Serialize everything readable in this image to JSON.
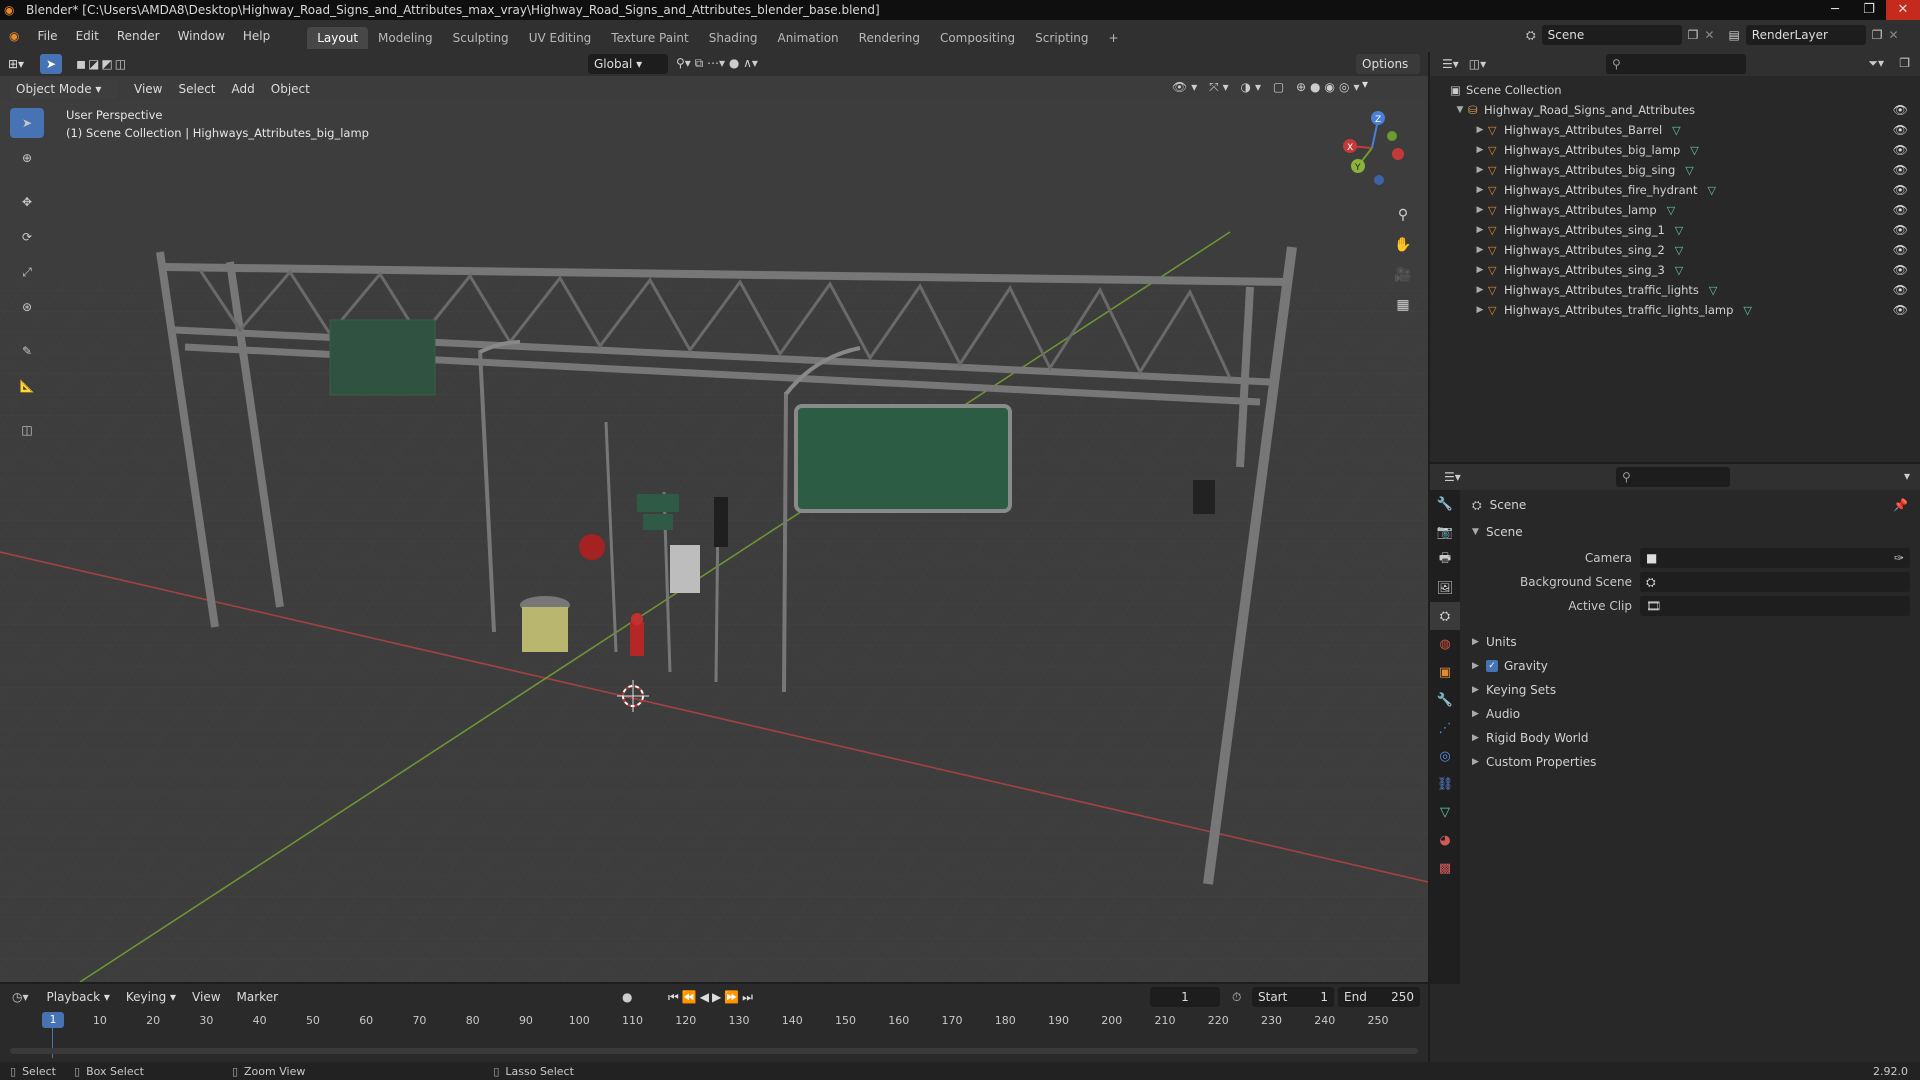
{
  "window": {
    "title": "Blender* [C:\\Users\\AMDA8\\Desktop\\Highway_Road_Signs_and_Attributes_max_vray\\Highway_Road_Signs_and_Attributes_blender_base.blend]",
    "minimize": "─",
    "maximize": "❐",
    "close": "✕"
  },
  "menu": [
    "File",
    "Edit",
    "Render",
    "Window",
    "Help"
  ],
  "workspaces": [
    "Layout",
    "Modeling",
    "Sculpting",
    "UV Editing",
    "Texture Paint",
    "Shading",
    "Animation",
    "Rendering",
    "Compositing",
    "Scripting"
  ],
  "workspace_add": "+",
  "scene_field": "Scene",
  "renderlayer_field": "RenderLayer",
  "viewport": {
    "transform_orientation": "Global",
    "options_label": "Options",
    "mode": "Object Mode",
    "header_menus": [
      "View",
      "Select",
      "Add",
      "Object"
    ],
    "overlay_title": "User Perspective",
    "overlay_sub": "(1) Scene Collection | Highways_Attributes_big_lamp",
    "gizmo": {
      "x": "X",
      "y": "Y",
      "z": "Z"
    }
  },
  "outliner": {
    "root": "Scene Collection",
    "collection": "Highway_Road_Signs_and_Attributes",
    "items": [
      "Highways_Attributes_Barrel",
      "Highways_Attributes_big_lamp",
      "Highways_Attributes_big_sing",
      "Highways_Attributes_fire_hydrant",
      "Highways_Attributes_lamp",
      "Highways_Attributes_sing_1",
      "Highways_Attributes_sing_2",
      "Highways_Attributes_sing_3",
      "Highways_Attributes_traffic_lights",
      "Highways_Attributes_traffic_lights_lamp"
    ]
  },
  "properties": {
    "context": "Scene",
    "panel": "Scene",
    "camera_label": "Camera",
    "bgscene_label": "Background Scene",
    "clip_label": "Active Clip",
    "sections": [
      "Units",
      "Gravity",
      "Keying Sets",
      "Audio",
      "Rigid Body World",
      "Custom Properties"
    ]
  },
  "timeline": {
    "menus": [
      "Playback",
      "Keying",
      "View",
      "Marker"
    ],
    "current_frame": "1",
    "start_label": "Start",
    "start": "1",
    "end_label": "End",
    "end": "250",
    "ticks": [
      "1",
      "10",
      "20",
      "30",
      "40",
      "50",
      "60",
      "70",
      "80",
      "90",
      "100",
      "110",
      "120",
      "130",
      "140",
      "150",
      "160",
      "170",
      "180",
      "190",
      "200",
      "210",
      "220",
      "230",
      "240",
      "250"
    ]
  },
  "status": {
    "select": "Select",
    "box_select": "Box Select",
    "zoom_view": "Zoom View",
    "lasso_select": "Lasso Select",
    "version": "2.92.0"
  },
  "colors": {
    "accent": "#4772b3",
    "x_axis": "#c33a3a",
    "y_axis": "#6a9c2f",
    "mesh": "#e28a34"
  }
}
